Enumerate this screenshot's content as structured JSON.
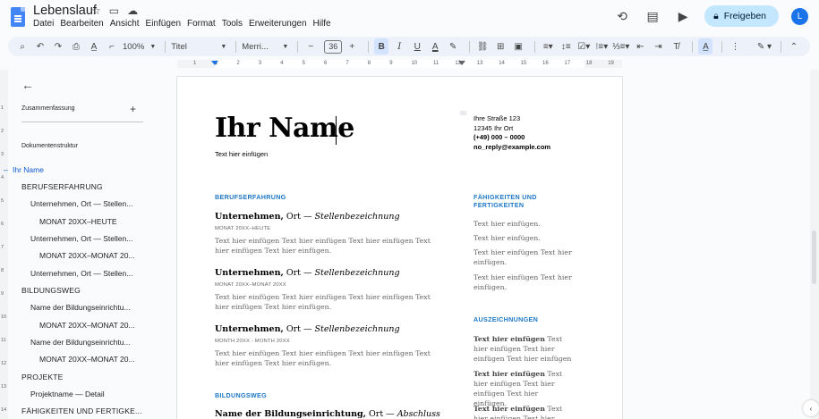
{
  "app": {
    "title": "Lebenslauf",
    "menu": [
      "Datei",
      "Bearbeiten",
      "Ansicht",
      "Einfügen",
      "Format",
      "Tools",
      "Erweiterungen",
      "Hilfe"
    ],
    "share_label": "Freigeben",
    "avatar_letter": "L"
  },
  "toolbar": {
    "zoom": "100%",
    "style": "Titel",
    "font": "Merri...",
    "font_size": "36",
    "bold": "B",
    "italic": "I",
    "underline": "U",
    "text_color": "A"
  },
  "ruler": {
    "labels": [
      "1",
      "1",
      "2",
      "3",
      "4",
      "5",
      "6",
      "7",
      "8",
      "9",
      "10",
      "11",
      "12",
      "13",
      "14",
      "15",
      "16",
      "17",
      "18",
      "19"
    ]
  },
  "vruler": {
    "labels": [
      "1",
      "2",
      "3",
      "4",
      "5",
      "6",
      "7",
      "8",
      "9",
      "10",
      "11",
      "12",
      "13",
      "14"
    ]
  },
  "sidebar": {
    "summary_label": "Zusammenfassung",
    "outline_label": "Dokumentenstruktur",
    "items": [
      {
        "label": "Ihr Name",
        "level": 0,
        "active": true
      },
      {
        "label": "BERUFSERFAHRUNG",
        "level": 1
      },
      {
        "label": "Unternehmen, Ort — Stellen...",
        "level": 2
      },
      {
        "label": "MONAT 20XX–HEUTE",
        "level": 3
      },
      {
        "label": "Unternehmen, Ort — Stellen...",
        "level": 2
      },
      {
        "label": "MONAT 20XX–MONAT 20...",
        "level": 3
      },
      {
        "label": "Unternehmen, Ort — Stellen...",
        "level": 2
      },
      {
        "label": "BILDUNGSWEG",
        "level": 1
      },
      {
        "label": "Name der Bildungseinrichtu...",
        "level": 2
      },
      {
        "label": "MONAT 20XX–MONAT 20...",
        "level": 3
      },
      {
        "label": "Name der Bildungseinrichtu...",
        "level": 2
      },
      {
        "label": "MONAT 20XX–MONAT 20...",
        "level": 3
      },
      {
        "label": "PROJEKTE",
        "level": 1
      },
      {
        "label": "Projektname — Detail",
        "level": 2
      },
      {
        "label": "FÄHIGKEITEN UND FERTIGKE...",
        "level": 1
      }
    ]
  },
  "document": {
    "name": "Ihr Name",
    "subtitle": "Text hier einfügen",
    "address": [
      "Ihre Straße 123",
      "12345 Ihr Ort",
      "(+49) 000 – 0000",
      "no_reply@example.com"
    ],
    "experience_heading": "BERUFSERFAHRUNG",
    "jobs": [
      {
        "company": "Unternehmen,",
        "place": " Ort — ",
        "position": "Stellenbezeichnung",
        "date": "MONAT 20XX–HEUTE",
        "desc": "Text hier einfügen Text hier einfügen Text hier einfügen Text hier einfügen Text hier einfügen."
      },
      {
        "company": "Unternehmen,",
        "place": " Ort — ",
        "position": "Stellenbezeichnung",
        "date": "MONAT 20XX–MONAT 20XX",
        "desc": "Text hier einfügen Text hier einfügen Text hier einfügen Text hier einfügen Text hier einfügen."
      },
      {
        "company": "Unternehmen,",
        "place": " Ort — ",
        "position": "Stellenbezeichnung",
        "date": "MONTH 20XX - MONTH 20XX",
        "desc": "Text hier einfügen Text hier einfügen Text hier einfügen Text hier einfügen Text hier einfügen."
      }
    ],
    "education_heading": "BILDUNGSWEG",
    "education_first": {
      "name": "Name der Bildungseinrichtung,",
      "place": " Ort — ",
      "degree": "Abschluss"
    },
    "skills_heading": "FÄHIGKEITEN UND FERTIGKEITEN",
    "skills": [
      "Text hier einfügen.",
      "Text hier einfügen.",
      "Text hier einfügen Text hier einfügen.",
      "Text hier einfügen Text hier einfügen."
    ],
    "awards_heading": "AUSZEICHNUNGEN",
    "awards": [
      {
        "bold": "Text hier einfügen",
        "rest": " Text hier einfügen Text hier einfügen Text hier einfügen"
      },
      {
        "bold": "Text hier einfügen",
        "rest": " Text hier einfügen Text hier einfügen Text hier einfügen."
      },
      {
        "bold": "Text hier einfügen",
        "rest": " Text hier einfügen Text hier einfügen"
      }
    ]
  }
}
